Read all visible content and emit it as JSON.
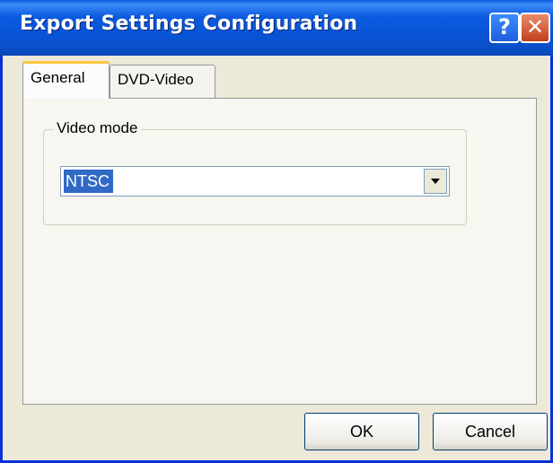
{
  "window": {
    "title": "Export Settings Configuration"
  },
  "titlebar": {
    "help_label": "?",
    "close_label": "✕"
  },
  "tabs": [
    {
      "label": "General",
      "selected": true
    },
    {
      "label": "DVD-Video",
      "selected": false
    }
  ],
  "general": {
    "group_label": "Video mode",
    "video_mode": {
      "value": "NTSC"
    }
  },
  "buttons": {
    "ok_label": "OK",
    "cancel_label": "Cancel"
  },
  "icons": {
    "help": "help-icon",
    "close": "close-icon",
    "dropdown": "chevron-down-icon"
  },
  "colors": {
    "titlebar": "#0854d7",
    "selection": "#316ac5",
    "active_tab_accent": "#ffc83c",
    "close_button": "#c1401c"
  }
}
